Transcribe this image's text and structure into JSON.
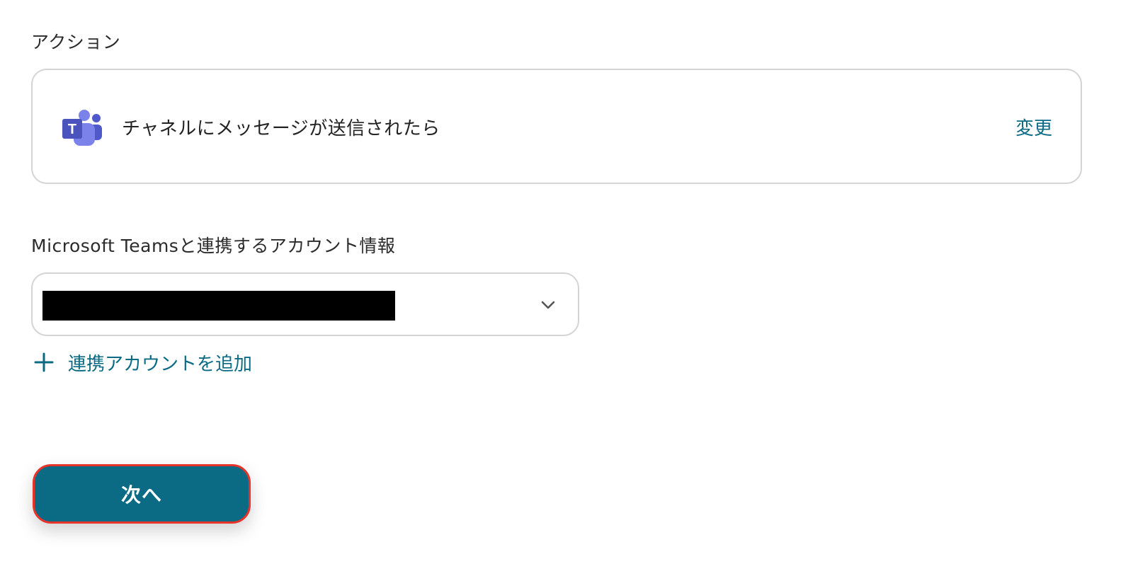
{
  "action_section": {
    "label": "アクション",
    "app_icon": "microsoft-teams-icon",
    "action_name": "チャネルにメッセージが送信されたら",
    "change_label": "変更"
  },
  "account_section": {
    "label": "Microsoft Teamsと連携するアカウント情報",
    "select_icon": "chevron-down-icon",
    "add_icon": "plus-icon",
    "add_label": "連携アカウントを追加"
  },
  "footer": {
    "next_label": "次へ"
  },
  "colors": {
    "accent": "#0b6b84",
    "highlight_border": "#e8332a",
    "card_border": "#d4d4d4",
    "teams_purple": "#5059c9"
  }
}
